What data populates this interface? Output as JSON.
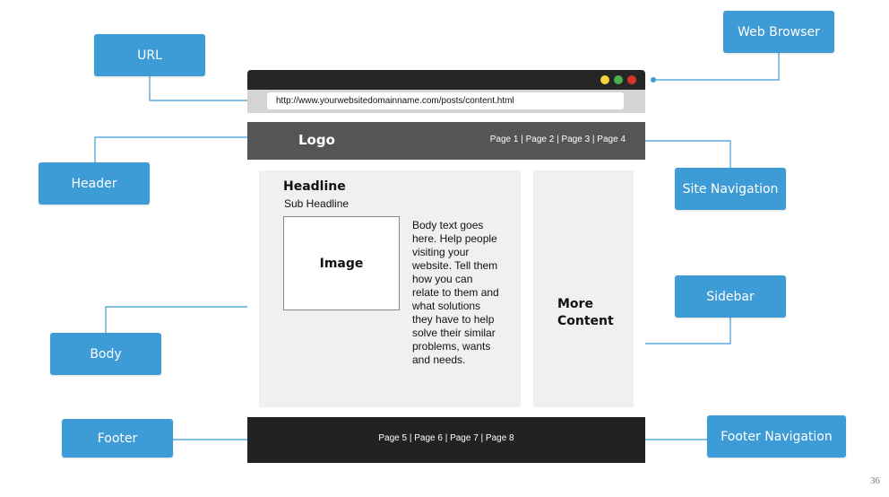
{
  "callouts": {
    "url": "URL",
    "web_browser": "Web Browser",
    "header": "Header",
    "site_navigation": "Site Navigation",
    "sidebar": "Sidebar",
    "body": "Body",
    "footer": "Footer",
    "footer_navigation": "Footer Navigation"
  },
  "browser": {
    "window_controls": [
      "#f5d33b",
      "#4caf50",
      "#d9332d"
    ],
    "url": "http://www.yourwebsitedomainname.com/posts/content.html"
  },
  "site": {
    "logo": "Logo",
    "nav": "Page 1 | Page 2 | Page 3 | Page 4",
    "headline": "Headline",
    "subheadline": "Sub Headline",
    "image_label": "Image",
    "body_text": "Body text goes here. Help people visiting your website. Tell them how you can relate to them and what solutions they have to help solve their similar problems, wants and needs.",
    "sidebar_text": "More Content",
    "footer_nav": "Page 5 | Page 6 | Page 7 | Page 8"
  },
  "colors": {
    "callout": "#3d9bd6",
    "connector": "#3d9bd6"
  },
  "page_number": "36"
}
